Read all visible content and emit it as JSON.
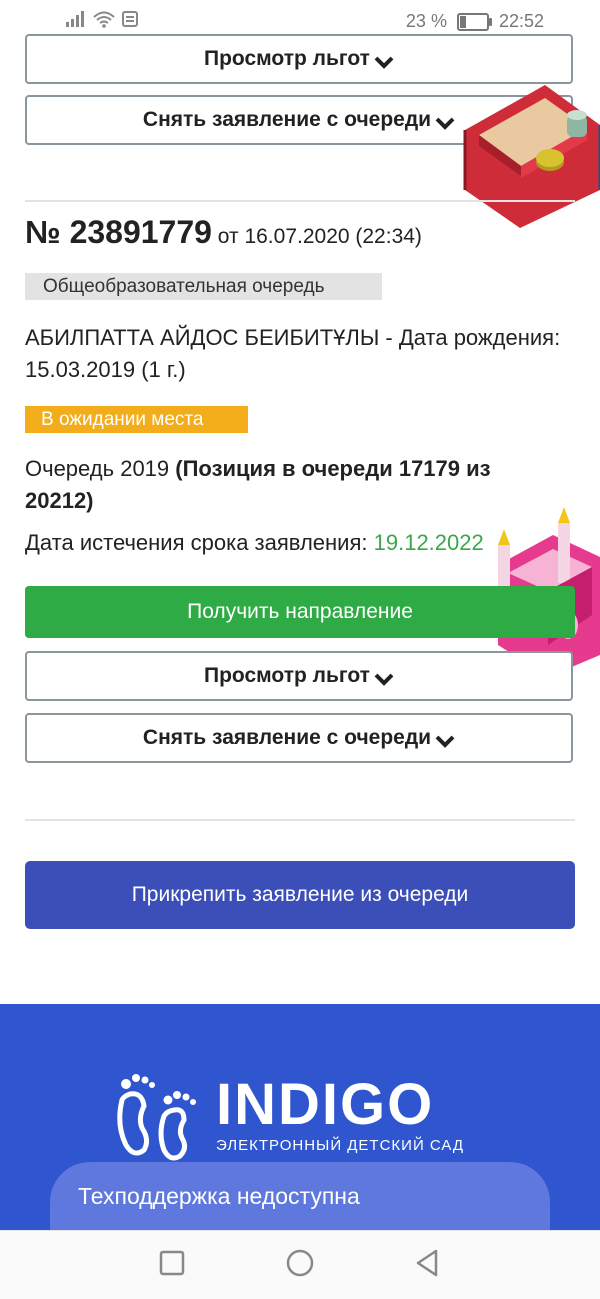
{
  "status_bar": {
    "battery_percent": "23 %",
    "time": "22:52",
    "battery_level": 0.23,
    "icons": [
      "signal-icon",
      "wifi-icon",
      "notification-icon",
      "battery-icon"
    ]
  },
  "top_card": {
    "benefits_button": "Просмотр льгот",
    "withdraw_button": "Снять заявление с очереди"
  },
  "application": {
    "number_prefix": "№",
    "number": "23891779",
    "date_text": "от 16.07.2020 (22:34)",
    "queue_type": "Общеобразовательная очередь",
    "child_line": "АБИЛПАТТА АЙДОС БЕИБИТҰЛЫ - Дата рождения: 15.03.2019 (1 г.)",
    "status_badge": "В ожидании места",
    "queue_label": "Очередь 2019",
    "queue_position": "(Позиция в очереди 17179 из 20212)",
    "expire_label": "Дата истечения срока заявления:",
    "expire_date": "19.12.2022",
    "get_referral_button": "Получить направление",
    "benefits_button": "Просмотр льгот",
    "withdraw_button": "Снять заявление с очереди"
  },
  "attach_button": "Прикрепить заявление из очереди",
  "footer": {
    "logo_title": "INDIGO",
    "logo_subtitle": "ЭЛЕКТРОННЫЙ ДЕТСКИЙ САД",
    "support_text": "Техподдержка недоступна"
  },
  "colors": {
    "green": "#2eab45",
    "indigo_button": "#3c4eb8",
    "footer_blue": "#2f56cf",
    "badge_orange": "#f4ad1a",
    "date_green": "#3aa84a"
  },
  "navigation": [
    "recent-apps-icon",
    "home-icon",
    "back-icon"
  ]
}
